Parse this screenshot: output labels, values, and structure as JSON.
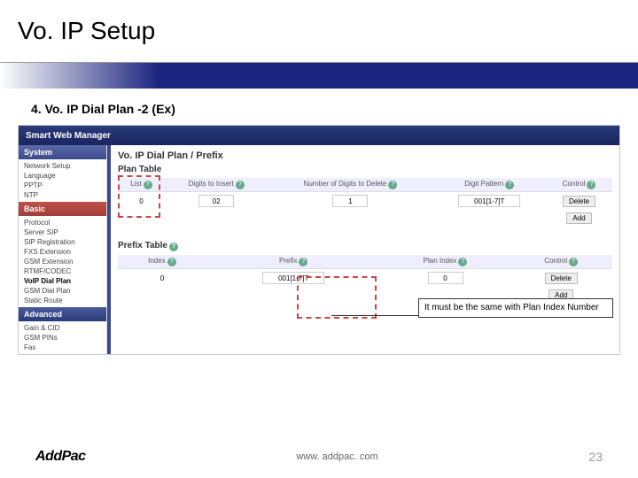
{
  "title": "Vo. IP Setup",
  "subtitle": "4. Vo. IP Dial Plan -2 (Ex)",
  "app": {
    "header": "Smart Web Manager",
    "sidebar": {
      "sections": [
        {
          "title": "System",
          "items": [
            "Network Setup",
            "Language",
            "PPTP",
            "NTP"
          ]
        },
        {
          "title": "Basic",
          "items": [
            "Protocol",
            "Server SIP",
            "SIP Registration",
            "FXS Extension",
            "GSM Extension",
            "RTMF/CODEC",
            "VoIP Dial Plan",
            "GSM Dial Plan",
            "Static Route"
          ]
        },
        {
          "title": "Advanced",
          "items": [
            "Gain & CID",
            "GSM PINs",
            "Fax"
          ]
        }
      ]
    },
    "panel": {
      "title": "Vo. IP Dial Plan / Prefix",
      "plan_section": "Plan Table",
      "plan_headers": [
        "List",
        "Digits to Insert",
        "Number of Digits to Delete",
        "Digit Pattern",
        "Control"
      ],
      "plan_row": {
        "list": "0",
        "insert": "02",
        "delete": "1",
        "pattern": "001[1-7]T",
        "btn_delete": "Delete",
        "btn_add": "Add"
      },
      "prefix_section": "Prefix Table",
      "prefix_headers": [
        "Index",
        "Prefix",
        "Plan Index",
        "Control"
      ],
      "prefix_row": {
        "index": "0",
        "prefix": "001[1-7]T",
        "planindex": "0",
        "btn_delete": "Delete",
        "btn_add": "Add"
      }
    }
  },
  "callout": "It must be the same with Plan Index Number",
  "footer": {
    "brand": "AddPac",
    "url": "www. addpac. com",
    "page": "23"
  }
}
